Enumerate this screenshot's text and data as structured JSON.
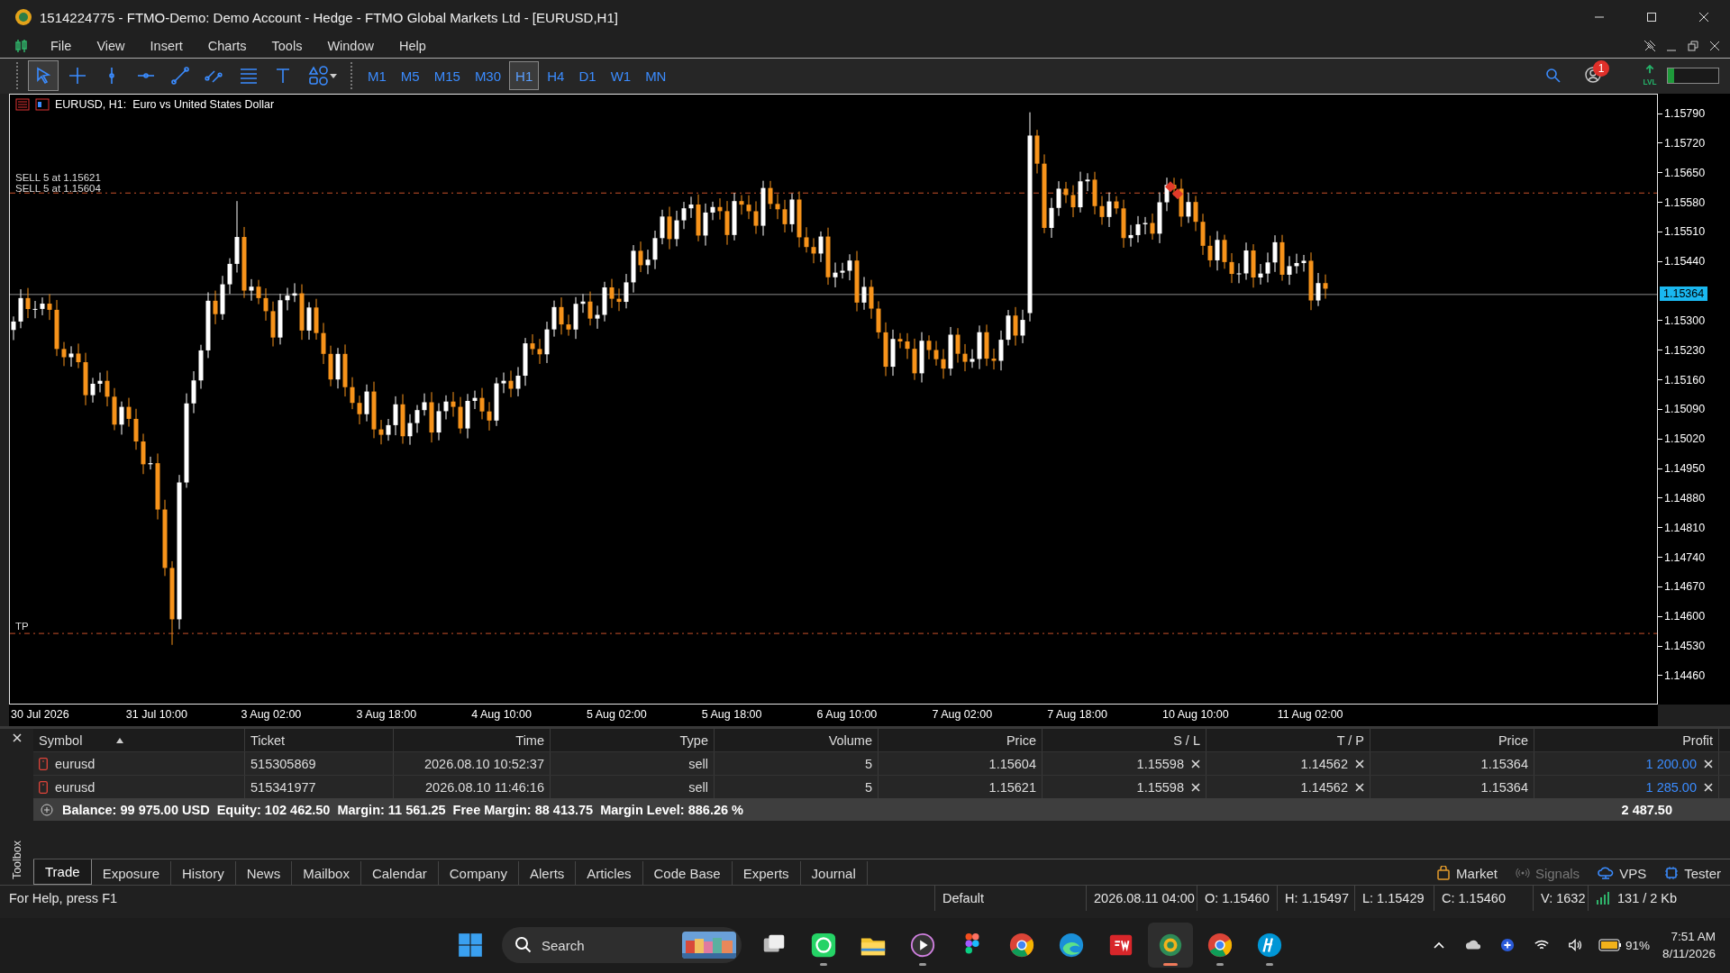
{
  "window": {
    "title": "1514224775 - FTMO-Demo: Demo Account - Hedge - FTMO Global Markets Ltd - [EURUSD,H1]"
  },
  "menu": [
    "File",
    "View",
    "Insert",
    "Charts",
    "Tools",
    "Window",
    "Help"
  ],
  "toolbar": {
    "tools": [
      {
        "kind": "cursor",
        "selected": true
      },
      {
        "kind": "crosshair",
        "selected": false
      },
      {
        "kind": "vline",
        "selected": false
      },
      {
        "kind": "hline",
        "selected": false
      },
      {
        "kind": "trendline",
        "selected": false
      },
      {
        "kind": "channel",
        "selected": false
      },
      {
        "kind": "fibo",
        "selected": false
      },
      {
        "kind": "text",
        "selected": false
      },
      {
        "kind": "shapes",
        "selected": false
      }
    ],
    "timeframes": [
      {
        "label": "M1",
        "selected": false
      },
      {
        "label": "M5",
        "selected": false
      },
      {
        "label": "M15",
        "selected": false
      },
      {
        "label": "M30",
        "selected": false
      },
      {
        "label": "H1",
        "selected": true
      },
      {
        "label": "H4",
        "selected": false
      },
      {
        "label": "D1",
        "selected": false
      },
      {
        "label": "W1",
        "selected": false
      },
      {
        "label": "MN",
        "selected": false
      }
    ],
    "notification_count": "1",
    "lvl_label": "LVL",
    "connection_meter": {
      "level": 0.12
    }
  },
  "chart": {
    "header": "EURUSD, H1:  Euro vs United States Dollar",
    "order_lines": [
      {
        "label": "SELL 5 at 1.15621"
      },
      {
        "label": "SELL 5 at 1.15604"
      }
    ],
    "tp_label": "TP",
    "current_price": "1.15364",
    "price_ticks": [
      "1.15790",
      "1.15720",
      "1.15650",
      "1.15580",
      "1.15510",
      "1.15440",
      "1.15300",
      "1.15230",
      "1.15160",
      "1.15090",
      "1.15020",
      "1.14950",
      "1.14880",
      "1.14810",
      "1.14740",
      "1.14670",
      "1.14600",
      "1.14530",
      "1.14460"
    ],
    "time_labels": [
      "30 Jul 2026",
      "31 Jul 10:00",
      "3 Aug 02:00",
      "3 Aug 18:00",
      "4 Aug 10:00",
      "5 Aug 02:00",
      "5 Aug 18:00",
      "6 Aug 10:00",
      "7 Aug 02:00",
      "7 Aug 18:00",
      "10 Aug 10:00",
      "11 Aug 02:00"
    ]
  },
  "toolbox": {
    "side_label": "Toolbox",
    "columns": [
      "Symbol",
      "Ticket",
      "Time",
      "Type",
      "Volume",
      "Price",
      "S / L",
      "T / P",
      "Price",
      "Profit"
    ],
    "rows": [
      {
        "symbol": "eurusd",
        "ticket": "515305869",
        "time": "2026.08.10 10:52:37",
        "type": "sell",
        "volume": "5",
        "price": "1.15604",
        "sl": "1.15598",
        "tp": "1.14562",
        "current_price": "1.15364",
        "profit": "1 200.00"
      },
      {
        "symbol": "eurusd",
        "ticket": "515341977",
        "time": "2026.08.10 11:46:16",
        "type": "sell",
        "volume": "5",
        "price": "1.15621",
        "sl": "1.15598",
        "tp": "1.14562",
        "current_price": "1.15364",
        "profit": "1 285.00"
      }
    ],
    "summary": "Balance: 99 975.00 USD  Equity: 102 462.50  Margin: 11 561.25  Free Margin: 88 413.75  Margin Level: 886.26 %",
    "total": "2 487.50",
    "tabs": [
      {
        "label": "Trade",
        "selected": true
      },
      {
        "label": "Exposure",
        "selected": false
      },
      {
        "label": "History",
        "selected": false
      },
      {
        "label": "News",
        "selected": false
      },
      {
        "label": "Mailbox",
        "selected": false
      },
      {
        "label": "Calendar",
        "selected": false
      },
      {
        "label": "Company",
        "selected": false
      },
      {
        "label": "Alerts",
        "selected": false
      },
      {
        "label": "Articles",
        "selected": false
      },
      {
        "label": "Code Base",
        "selected": false
      },
      {
        "label": "Experts",
        "selected": false
      },
      {
        "label": "Journal",
        "selected": false
      }
    ],
    "services": [
      {
        "label": "Market",
        "kind": "market",
        "disabled": false
      },
      {
        "label": "Signals",
        "kind": "signals",
        "disabled": true
      },
      {
        "label": "VPS",
        "kind": "vps",
        "disabled": false
      },
      {
        "label": "Tester",
        "kind": "tester",
        "disabled": false
      }
    ]
  },
  "status_bar": {
    "help": "For Help, press F1",
    "fields": [
      "Default",
      "2026.08.11 04:00",
      "O: 1.15460",
      "H: 1.15497",
      "L: 1.15429",
      "C: 1.15460",
      "V: 1632"
    ],
    "traffic": "131 / 2 Kb"
  },
  "taskbar": {
    "search_placeholder": "Search",
    "apps": [
      {
        "kind": "taskview",
        "running": false,
        "active": false
      },
      {
        "kind": "whatsapp",
        "running": true,
        "active": false
      },
      {
        "kind": "files",
        "running": false,
        "active": false
      },
      {
        "kind": "player",
        "running": true,
        "active": false
      },
      {
        "kind": "figma",
        "running": false,
        "active": false
      },
      {
        "kind": "chrome",
        "running": false,
        "active": false
      },
      {
        "kind": "edge",
        "running": false,
        "active": false
      },
      {
        "kind": "sw",
        "running": false,
        "active": false
      },
      {
        "kind": "mt5",
        "running": true,
        "active": true
      },
      {
        "kind": "chrome",
        "running": true,
        "active": false
      },
      {
        "kind": "hp",
        "running": true,
        "active": false
      }
    ],
    "battery": "91%",
    "time": "7:51 AM",
    "date": "8/11/2026"
  }
}
